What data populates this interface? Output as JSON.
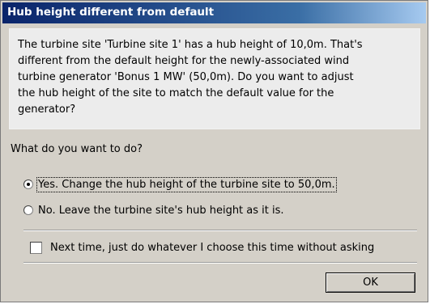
{
  "window": {
    "title": "Hub height different from default",
    "accent_colors": {
      "titlebar_start": "#0a246a",
      "titlebar_end": "#a6caf0",
      "dialog_bg": "#d4d0c8"
    }
  },
  "message": {
    "line1": "The turbine site 'Turbine site 1' has a hub height of 10,0m. That's",
    "line2": "different from the default height for the newly-associated wind",
    "line3": "turbine generator 'Bonus 1 MW' (50,0m). Do you want to adjust",
    "line4": "the hub height of the site to match the default value for the",
    "line5": "generator?"
  },
  "question": "What do you want to do?",
  "options": [
    {
      "label": "Yes. Change the hub height of the turbine site to 50,0m.",
      "selected": true
    },
    {
      "label": "No. Leave the turbine site's hub height as it is.",
      "selected": false
    }
  ],
  "remember_checkbox": {
    "label": "Next time, just do whatever I choose this time without asking",
    "checked": false
  },
  "buttons": {
    "ok_label": "OK"
  }
}
